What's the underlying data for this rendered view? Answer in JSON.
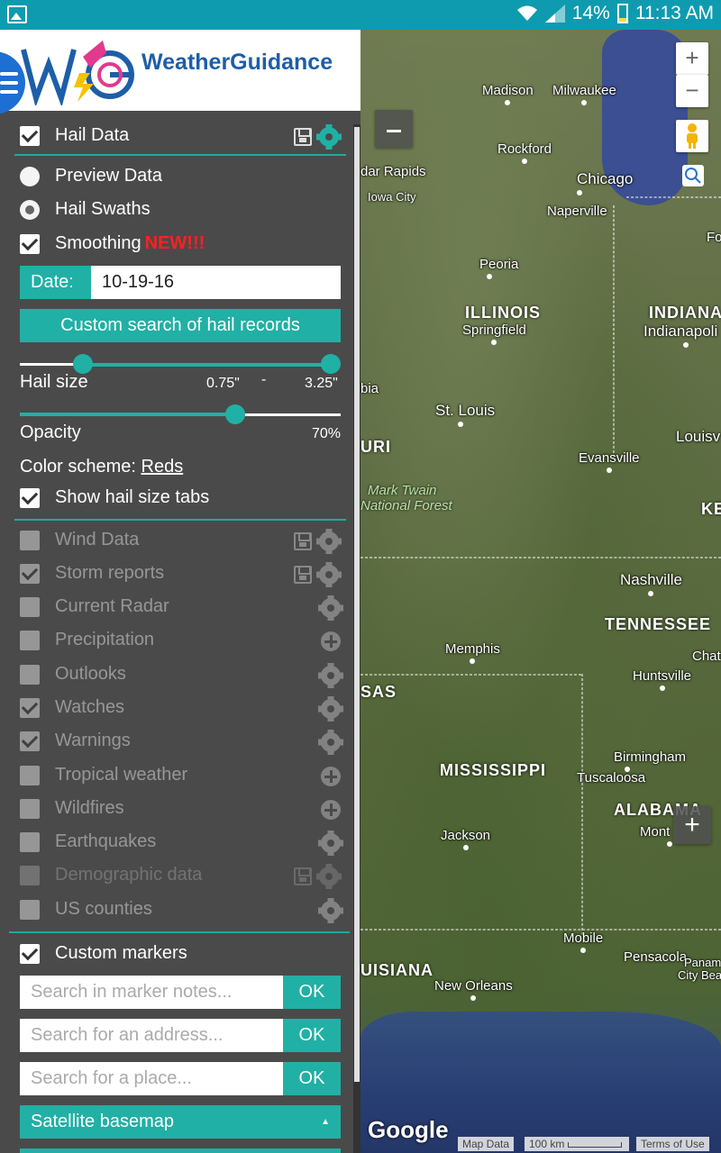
{
  "status_bar": {
    "battery": "14%",
    "time": "11:13 AM"
  },
  "brand": {
    "name": "WeatherGuidance"
  },
  "panel": {
    "hail": {
      "label": "Hail Data",
      "preview_label": "Preview Data",
      "swaths_label": "Hail Swaths",
      "smoothing_label": "Smoothing",
      "new_badge": "NEW!!!",
      "date_label": "Date:",
      "date_value": "10-19-16",
      "custom_search_label": "Custom search of hail records",
      "hail_size_label": "Hail size",
      "hail_min": "0.75\"",
      "hail_sep": "-",
      "hail_max": "3.25\"",
      "opacity_label": "Opacity",
      "opacity_value": "70%",
      "color_scheme_label": "Color scheme:",
      "color_scheme_value": "Reds",
      "show_tabs_label": "Show hail size tabs"
    },
    "layers": [
      {
        "label": "Wind Data"
      },
      {
        "label": "Storm reports"
      },
      {
        "label": "Current Radar"
      },
      {
        "label": "Precipitation"
      },
      {
        "label": "Outlooks"
      },
      {
        "label": "Watches"
      },
      {
        "label": "Warnings"
      },
      {
        "label": "Tropical weather"
      },
      {
        "label": "Wildfires"
      },
      {
        "label": "Earthquakes"
      },
      {
        "label": "Demographic data"
      },
      {
        "label": "US counties"
      }
    ],
    "markers": {
      "label": "Custom markers",
      "notes_placeholder": "Search in marker notes...",
      "address_placeholder": "Search for an address...",
      "place_placeholder": "Search for a place...",
      "ok_label": "OK"
    },
    "basemap": {
      "selected": "Satellite basemap"
    }
  },
  "map": {
    "cities": [
      "Madison",
      "Milwaukee",
      "Rockford",
      "Chicago",
      "Naperville",
      "dar Rapids",
      "Iowa City",
      "Peoria",
      "Springfield",
      "Indianapoli",
      "St. Louis",
      "Evansville",
      "Louisv",
      "Nashville",
      "Chat",
      "Memphis",
      "Huntsville",
      "Birmingham",
      "Tuscaloosa",
      "Jackson",
      "Mont",
      "Mobile",
      "Pensacola",
      "New Orleans",
      "Panam",
      "City Bea",
      "Fo",
      "bia"
    ],
    "states": [
      "ILLINOIS",
      "INDIANA",
      "URI",
      "KE",
      "TENNESSEE",
      "SAS",
      "MISSISSIPPI",
      "ALABAMA",
      "UISIANA"
    ],
    "forest": [
      "Mark Twain",
      "National Forest"
    ],
    "google": "Google",
    "attribution": {
      "map_data": "Map Data",
      "scale": "100 km",
      "terms": "Terms of Use"
    },
    "zoom_in": "+",
    "zoom_out": "−"
  }
}
